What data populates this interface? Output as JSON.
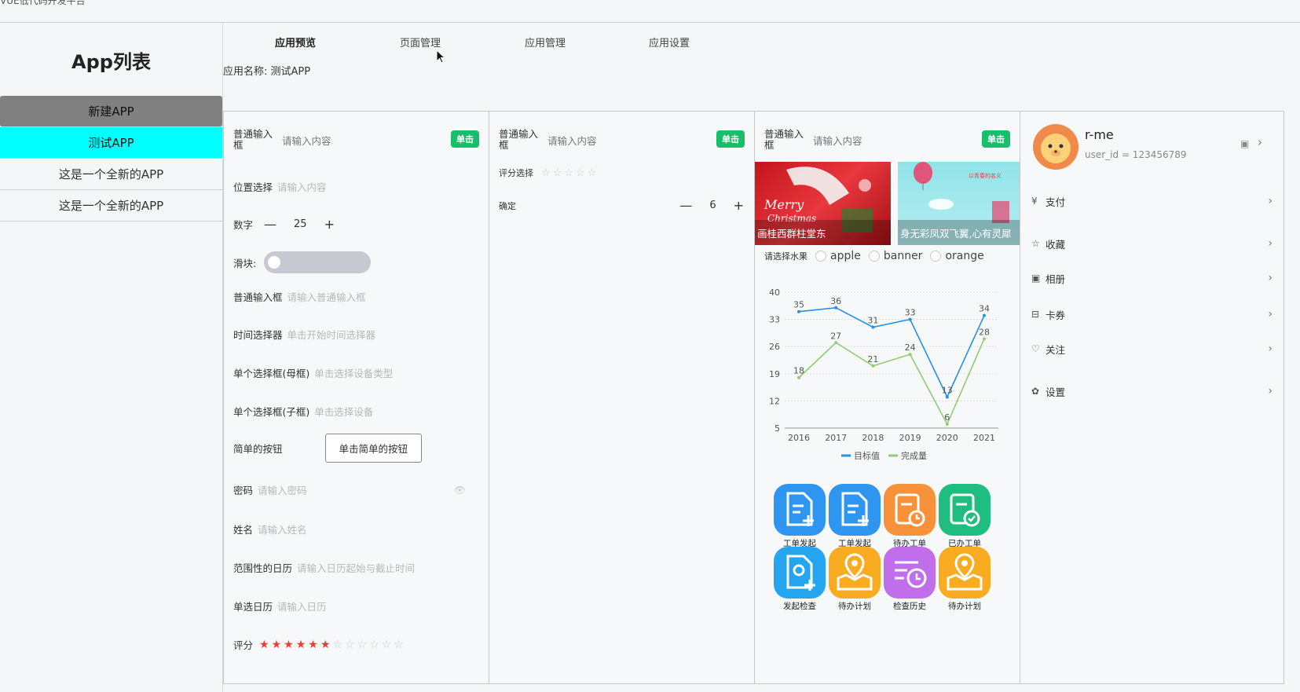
{
  "window": {
    "title": "VUE低代码开发平台"
  },
  "sidebar": {
    "title": "App列表",
    "items": [
      {
        "label": "新建APP"
      },
      {
        "label": "测试APP"
      },
      {
        "label": "这是一个全新的APP"
      },
      {
        "label": "这是一个全新的APP"
      }
    ]
  },
  "tabs": [
    {
      "label": "应用预览"
    },
    {
      "label": "页面管理"
    },
    {
      "label": "应用管理"
    },
    {
      "label": "应用设置"
    }
  ],
  "app_name": {
    "label": "应用名称:",
    "value": "测试APP"
  },
  "panel1": {
    "top_input": {
      "label": "普通输入框",
      "placeholder": "请输入内容",
      "button": "单击"
    },
    "location": {
      "label": "位置选择",
      "placeholder": "请输入内容"
    },
    "number": {
      "label": "数字",
      "minus": "—",
      "value": "25",
      "plus": "+"
    },
    "slider": {
      "label": "滑块:",
      "value": 0
    },
    "normal_input": {
      "label": "普通输入框",
      "placeholder": "请输入普通输入框"
    },
    "time_picker": {
      "label": "时间选择器",
      "placeholder": "单击开始时间选择器"
    },
    "parent_select": {
      "label": "单个选择框(母框)",
      "placeholder": "单击选择设备类型"
    },
    "child_select": {
      "label": "单个选择框(子框)",
      "placeholder": "单击选择设备"
    },
    "simple_button": {
      "label": "简单的按钮",
      "button": "单击简单的按钮"
    },
    "password": {
      "label": "密码",
      "placeholder": "请输入密码"
    },
    "name": {
      "label": "姓名",
      "placeholder": "请输入姓名"
    },
    "range_calendar": {
      "label": "范围性的日历",
      "placeholder": "请输入日历起始与截止时间"
    },
    "single_calendar": {
      "label": "单选日历",
      "placeholder": "请输入日历"
    },
    "rating": {
      "label": "评分",
      "value": 6,
      "max": 12
    }
  },
  "panel2": {
    "top_input": {
      "label": "普通输入框",
      "placeholder": "请输入内容",
      "button": "单击"
    },
    "rating": {
      "label": "评分选择",
      "value": 0,
      "max": 5
    },
    "confirm": {
      "label": "确定",
      "minus": "—",
      "value": "6",
      "plus": "+"
    }
  },
  "panel3": {
    "top_input": {
      "label": "普通输入框",
      "placeholder": "请输入内容",
      "button": "单击"
    },
    "banners": [
      {
        "caption": "画桂西群柱堂东"
      },
      {
        "caption": "身无彩凤双飞翼,心有灵犀"
      }
    ],
    "fruit": {
      "label": "请选择水果",
      "options": [
        "apple",
        "banner",
        "orange"
      ]
    },
    "icons": [
      {
        "label": "工单发起",
        "icon": "doc-add-icon",
        "color": "#2e95f0"
      },
      {
        "label": "工单发起",
        "icon": "doc-add-icon",
        "color": "#2e95f0"
      },
      {
        "label": "待办工单",
        "icon": "doc-clock-icon",
        "color": "#f7913a"
      },
      {
        "label": "已办工单",
        "icon": "doc-check-icon",
        "color": "#1fbd80"
      },
      {
        "label": "发起检查",
        "icon": "location-add-icon",
        "color": "#25a4ef"
      },
      {
        "label": "待办计划",
        "icon": "map-pin-icon",
        "color": "#f9ab21"
      },
      {
        "label": "检查历史",
        "icon": "list-clock-icon",
        "color": "#c06ee9"
      },
      {
        "label": "待办计划",
        "icon": "map-pin-icon",
        "color": "#f9ab21"
      }
    ]
  },
  "chart_data": {
    "type": "line",
    "categories": [
      "2016",
      "2017",
      "2018",
      "2019",
      "2020",
      "2021"
    ],
    "series": [
      {
        "name": "目标值",
        "values": [
          35,
          36,
          31,
          33,
          13,
          34
        ],
        "color": "#2590e8"
      },
      {
        "name": "完成量",
        "values": [
          18,
          27,
          21,
          24,
          6,
          28
        ],
        "color": "#91cc75"
      }
    ],
    "y_ticks": [
      "40",
      "33",
      "26",
      "19",
      "12",
      "5"
    ],
    "ylim": [
      5,
      40
    ],
    "grid": true,
    "legend": "bottom"
  },
  "profile": {
    "name": "r-me",
    "user_id": "user_id = 123456789",
    "menu": [
      {
        "label": "支付",
        "icon": "pay-icon"
      },
      {
        "label": "收藏",
        "icon": "star-icon"
      },
      {
        "label": "相册",
        "icon": "photo-icon"
      },
      {
        "label": "卡券",
        "icon": "ticket-icon"
      },
      {
        "label": "关注",
        "icon": "heart-icon"
      },
      {
        "label": "设置",
        "icon": "gear-icon"
      }
    ]
  }
}
